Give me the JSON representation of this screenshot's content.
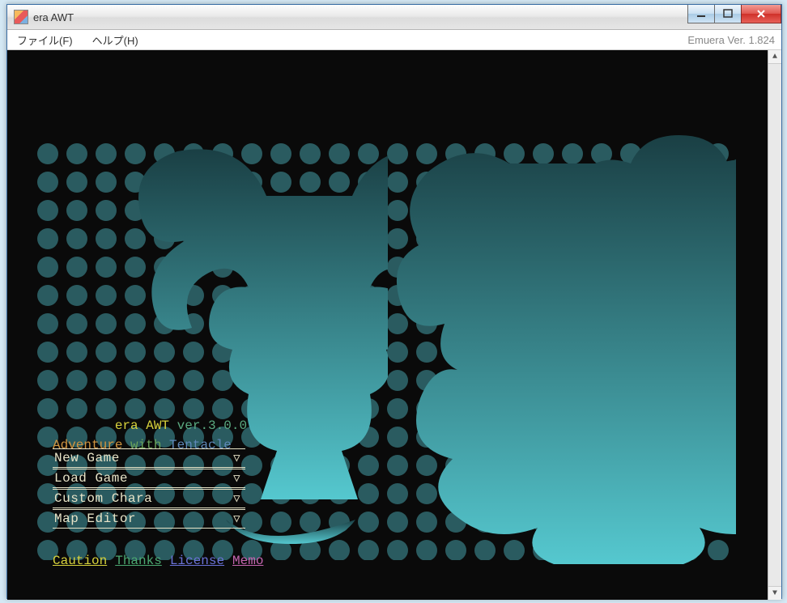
{
  "window": {
    "title": "era AWT",
    "version_label": "Emuera Ver. 1.824"
  },
  "menubar": {
    "file": "ファイル(F)",
    "help": "ヘルプ(H)"
  },
  "title_block": {
    "game_name": "era AWT",
    "version": "ver.3.0.0",
    "subtitle_a": "Adventure",
    "subtitle_b": "with",
    "subtitle_c": "Tentacle"
  },
  "main_menu": [
    {
      "label": "New Game"
    },
    {
      "label": "Load Game"
    },
    {
      "label": "Custom Chara"
    },
    {
      "label": "Map Editor"
    }
  ],
  "footer_links": {
    "caution": "Caution",
    "thanks": "Thanks",
    "license": "License",
    "memo": "Memo"
  },
  "colors": {
    "dot": "#2a5b60",
    "sil_top": "#1a3f44",
    "sil_bot": "#55c8cf"
  }
}
